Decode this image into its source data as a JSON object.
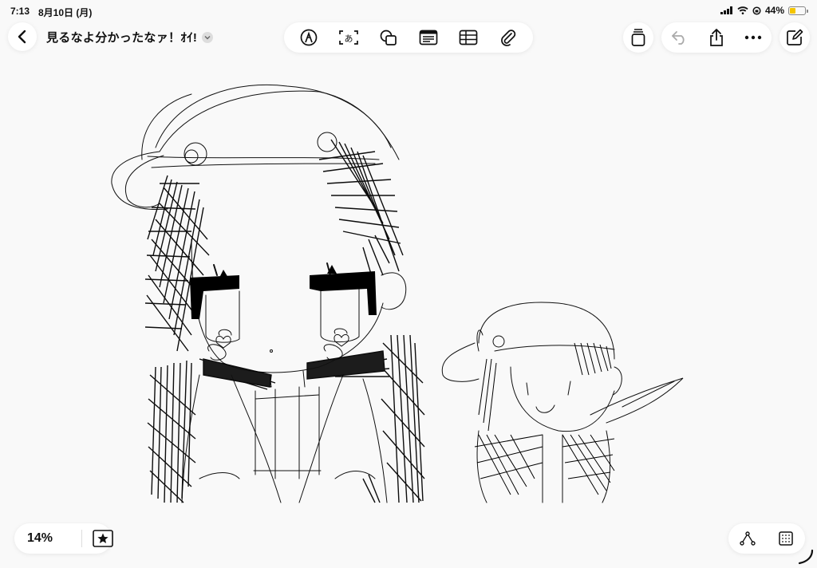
{
  "status": {
    "time": "7:13",
    "date": "8月10日 (月)",
    "battery": "44%",
    "battery_level": 0.44
  },
  "header": {
    "title": "見るなよ分かったなァ！ｵｲ!",
    "tools": [
      "pen-icon",
      "text-input-icon",
      "shapes-icon",
      "text-box-icon",
      "table-icon",
      "attachment-icon"
    ],
    "actions": [
      "copy-icon",
      "undo-icon",
      "share-icon",
      "more-icon",
      "compose-icon"
    ]
  },
  "footer": {
    "zoom": "14%"
  },
  "colors": {
    "background": "#f9f9f9",
    "ink": "#111111",
    "battery_fill": "#f4c500"
  }
}
